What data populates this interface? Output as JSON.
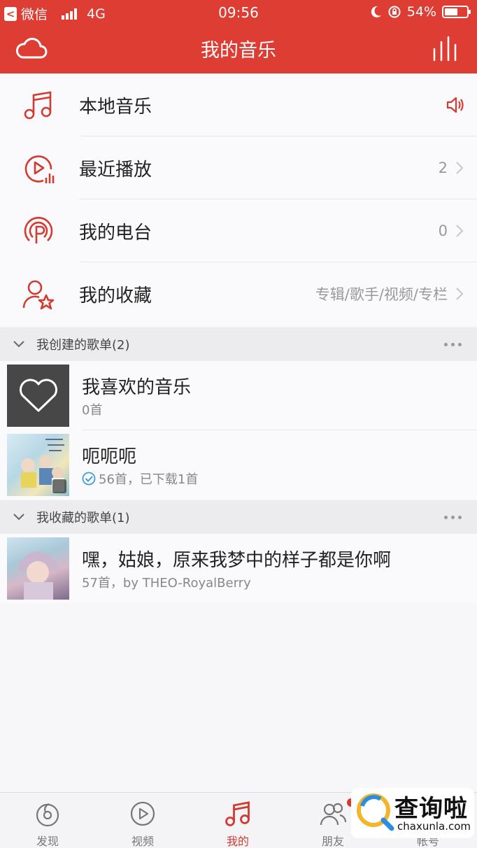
{
  "status_bar": {
    "app": "微信",
    "network": "4G",
    "time": "09:56",
    "battery": "54%"
  },
  "header": {
    "title": "我的音乐"
  },
  "menu": [
    {
      "label": "本地音乐",
      "meta": ""
    },
    {
      "label": "最近播放",
      "meta": "2"
    },
    {
      "label": "我的电台",
      "meta": "0"
    },
    {
      "label": "我的收藏",
      "meta": "专辑/歌手/视频/专栏"
    }
  ],
  "created_section": {
    "label": "我创建的歌单(2)"
  },
  "created_playlists": [
    {
      "name": "我喜欢的音乐",
      "sub": "0首"
    },
    {
      "name": "呃呃呃",
      "sub": "56首，已下载1首"
    }
  ],
  "favorited_section": {
    "label": "我收藏的歌单(1)"
  },
  "favorited_playlists": [
    {
      "name": "嘿，姑娘，原来我梦中的样子都是你啊",
      "sub": "57首，by THEO-RoyalBerry"
    }
  ],
  "tabs": [
    {
      "label": "发现",
      "icon": "discover-icon"
    },
    {
      "label": "视频",
      "icon": "video-icon"
    },
    {
      "label": "我的",
      "icon": "music-note-icon"
    },
    {
      "label": "朋友",
      "icon": "friends-icon"
    },
    {
      "label": "帐号",
      "icon": "account-icon"
    }
  ],
  "watermark": {
    "text": "查询啦",
    "domain": "chaxunla.com"
  },
  "colors": {
    "brand_red": "#dd3d33",
    "active_tab": "#d33a31"
  }
}
